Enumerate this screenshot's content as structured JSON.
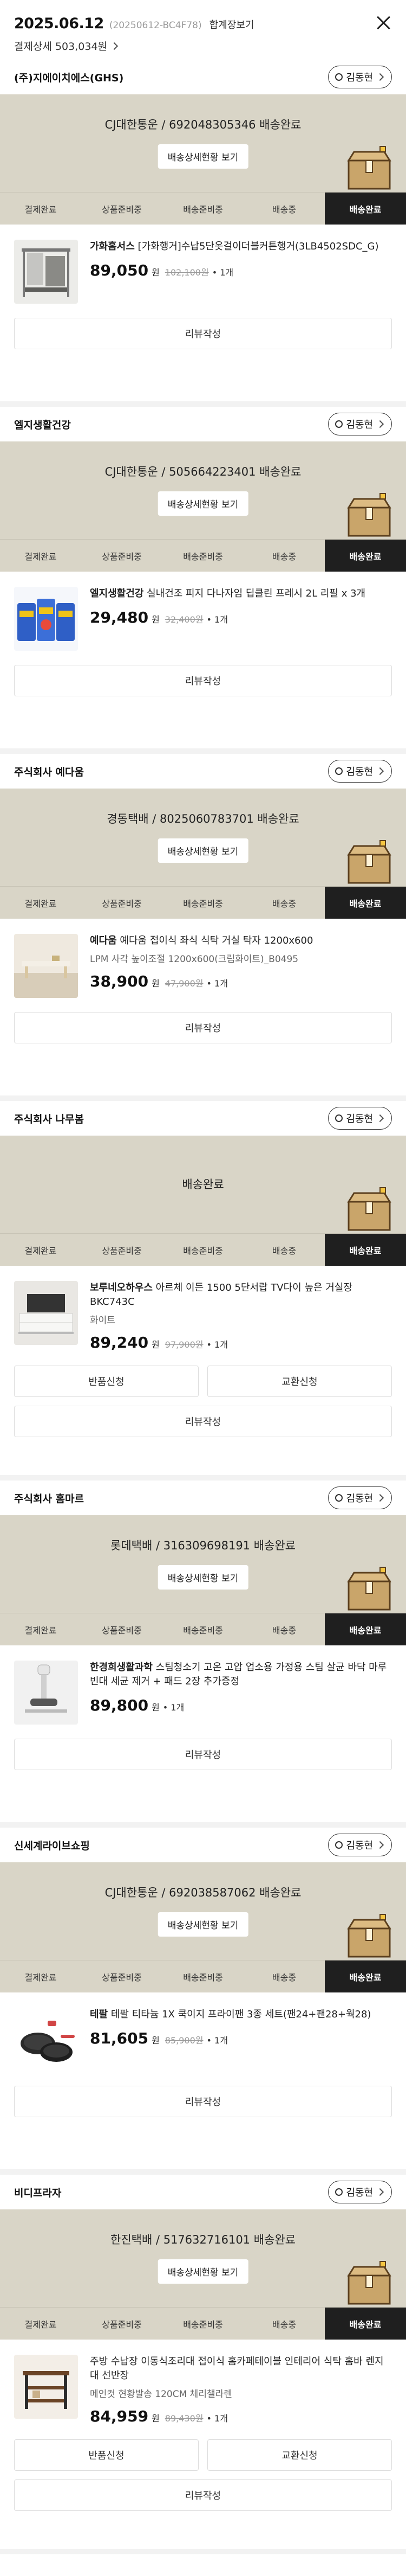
{
  "header": {
    "date": "2025.06.12",
    "order_code": "(20250612-BC4F78)",
    "merged_view": "합계장보기",
    "payment_detail": "결제상세 503,034원"
  },
  "steps": [
    "결제완료",
    "상품준비중",
    "배송준비중",
    "배송중",
    "배송완료"
  ],
  "sellers": [
    {
      "name": "(주)지에이치에스(GHS)",
      "contact": "김동현",
      "banner_title": "CJ대한통운 / 692048305346 배송완료",
      "banner_button": "배송상세현황 보기",
      "product_brand": "가화홈서스",
      "product_name": "[가화행거]수납5단옷걸이더블커튼행거(3LB4502SDC_G)",
      "option": "",
      "price": "89,050",
      "original": "102,100원",
      "qty": "1개",
      "buttons": [
        "리뷰작성"
      ]
    },
    {
      "name": "엘지생활건강",
      "contact": "김동현",
      "banner_title": "CJ대한통운 / 505664223401 배송완료",
      "banner_button": "배송상세현황 보기",
      "product_brand": "엘지생활건강",
      "product_name": "실내건조 피지 다나자임 딥클린 프레시 2L 리필 x 3개",
      "option": "",
      "price": "29,480",
      "original": "32,400원",
      "qty": "1개",
      "buttons": [
        "리뷰작성"
      ]
    },
    {
      "name": "주식회사 예다움",
      "contact": "김동현",
      "banner_title": "경동택배 / 8025060783701 배송완료",
      "banner_button": "배송상세현황 보기",
      "product_brand": "예다움",
      "product_name": "예다움 접이식 좌식 식탁 거실 탁자 1200x600",
      "option": "LPM 사각 높이조절 1200x600(크림화이트)_B0495",
      "price": "38,900",
      "original": "47,900원",
      "qty": "1개",
      "buttons": [
        "리뷰작성"
      ]
    },
    {
      "name": "주식회사 나무봄",
      "contact": "김동현",
      "banner_title": "배송완료",
      "banner_button": "",
      "product_brand": "보루네오하우스",
      "product_name": "아르체 이든 1500 5단서랍 TV다이 높은 거실장 BKC743C",
      "option": "화이트",
      "price": "89,240",
      "original": "97,900원",
      "qty": "1개",
      "buttons": [
        "반품신청",
        "교환신청",
        "리뷰작성"
      ]
    },
    {
      "name": "주식회사 홈마르",
      "contact": "김동현",
      "banner_title": "롯데택배 / 316309698191 배송완료",
      "banner_button": "배송상세현황 보기",
      "product_brand": "한경희생활과학",
      "product_name": "스팀청소기 고온 고압 업소용 가정용 스팀 살균 바닥 마루 빈대 세균 제거 + 패드 2장 추가증정",
      "option": "",
      "price": "89,800",
      "original": "",
      "qty": "1개",
      "buttons": [
        "리뷰작성"
      ]
    },
    {
      "name": "신세계라이브쇼핑",
      "contact": "김동현",
      "banner_title": "CJ대한통운 / 692038587062 배송완료",
      "banner_button": "배송상세현황 보기",
      "product_brand": "테팔",
      "product_name": "테팔 티타늄 1X 쿡이지 프라이팬 3종 세트(팬24+팬28+웍28)",
      "option": "",
      "price": "81,605",
      "original": "85,900원",
      "qty": "1개",
      "buttons": [
        "리뷰작성"
      ]
    },
    {
      "name": "비디프라자",
      "contact": "김동현",
      "banner_title": "한진택배 / 517632716101 배송완료",
      "banner_button": "배송상세현황 보기",
      "product_brand": "",
      "product_name": "주방 수납장 이동식조리대 접이식 홈카페테이블 인테리어 식탁 홈바 렌지대 선반장",
      "option": "메인컷 현황발송 120CM 체리챌라렌",
      "price": "84,959",
      "original": "89,430원",
      "qty": "1개",
      "buttons": [
        "반품신청",
        "교환신청",
        "리뷰작성"
      ]
    }
  ],
  "won_unit": "원",
  "qty_sep": "•",
  "colors": {
    "banner_bg": "#d9d5c7",
    "active_step_bg": "#1f1f1f",
    "separator": "#f2f2f2"
  }
}
